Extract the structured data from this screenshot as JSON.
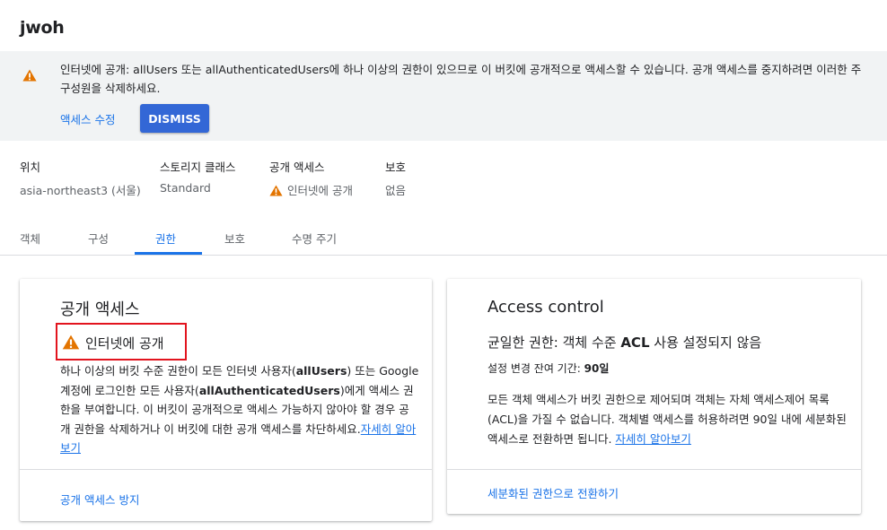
{
  "bucket": {
    "name": "jwoh"
  },
  "banner": {
    "message": "인터넷에 공개: allUsers 또는 allAuthenticatedUsers에 하나 이상의 권한이 있으므로 이 버킷에 공개적으로 액세스할 수 있습니다. 공개 액세스를 중지하려면 이러한 주 구성원을 삭제하세요.",
    "edit_link": "액세스 수정",
    "dismiss_label": "DISMISS",
    "icon": "warning-icon"
  },
  "meta": {
    "location_label": "위치",
    "location_value": "asia-northeast3 (서울)",
    "storage_class_label": "스토리지 클래스",
    "storage_class_value": "Standard",
    "public_access_label": "공개 액세스",
    "public_access_value": "인터넷에 공개",
    "protection_label": "보호",
    "protection_value": "없음"
  },
  "tabs": [
    {
      "label": "객체"
    },
    {
      "label": "구성"
    },
    {
      "label": "권한",
      "active": true
    },
    {
      "label": "보호"
    },
    {
      "label": "수명 주기"
    }
  ],
  "public_card": {
    "title": "공개 액세스",
    "status": "인터넷에 공개",
    "desc_1": "하나 이상의 버킷 수준 권한이 모든 인터넷 사용자(",
    "desc_b1": "allUsers",
    "desc_2": ") 또는 Google 계정에 로그인한 모든 사용자(",
    "desc_b2": "allAuthenticatedUsers",
    "desc_3": ")에게 액세스 권한을 부여합니다. 이 버킷이 공개적으로 액세스 가능하지 않아야 할 경우 공개 권한을 삭제하거나 이 버킷에 대한 공개 액세스를 차단하세요.",
    "learn_more": "자세히 알아보기",
    "action": "공개 액세스 방지"
  },
  "access_card": {
    "title": "Access control",
    "subhead_1": "균일한 권한: 객체 수준 ",
    "subhead_b": "ACL",
    "subhead_2": " 사용 설정되지 않음",
    "grace_label": "설정 변경 잔여 기간: ",
    "grace_value": "90일",
    "desc": "모든 객체 액세스가 버킷 권한으로 제어되며 객체는 자체 액세스제어 목록(ACL)을 가질 수 없습니다. 객체별 액세스를 허용하려면 90일 내에 세분화된 액세스로 전환하면 됩니다. ",
    "learn_more": "자세히 알아보기",
    "action": "세분화된 권한으로 전환하기"
  },
  "colors": {
    "accent": "#1a73e8",
    "button": "#3367d6",
    "warning": "#e37400",
    "highlight_border": "#e2141e",
    "banner_bg": "#f1f3f4"
  }
}
